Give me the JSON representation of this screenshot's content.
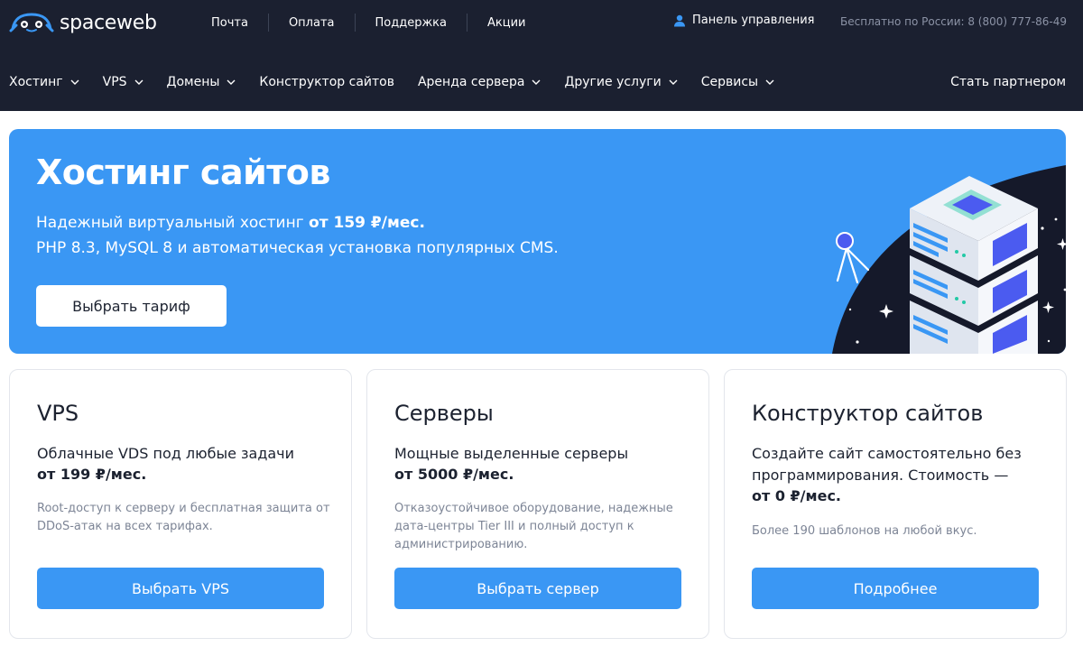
{
  "header": {
    "logo_text": "spaceweb",
    "top_links": [
      "Почта",
      "Оплата",
      "Поддержка",
      "Акции"
    ],
    "control_panel": "Панель управления",
    "phone": "Бесплатно по России: 8 (800) 777-86-49",
    "nav": [
      {
        "label": "Хостинг",
        "dropdown": true
      },
      {
        "label": "VPS",
        "dropdown": true
      },
      {
        "label": "Домены",
        "dropdown": true
      },
      {
        "label": "Конструктор сайтов",
        "dropdown": false
      },
      {
        "label": "Аренда сервера",
        "dropdown": true
      },
      {
        "label": "Другие услуги",
        "dropdown": true
      },
      {
        "label": "Сервисы",
        "dropdown": true
      }
    ],
    "partner": "Стать партнером"
  },
  "hero": {
    "title": "Хостинг сайтов",
    "line1_prefix": "Надежный виртуальный хостинг ",
    "line1_price": "от 159 ₽/мес.",
    "line2": "PHP 8.3, MySQL 8 и автоматическая установка популярных CMS.",
    "button": "Выбрать тариф"
  },
  "cards": [
    {
      "title": "VPS",
      "desc": "Облачные VDS под любые задачи",
      "price": "от 199 ₽/мес.",
      "note": "Root-доступ к серверу и бесплатная защита от DDoS-атак на всех тарифах.",
      "button": "Выбрать VPS"
    },
    {
      "title": "Серверы",
      "desc": "Мощные выделенные серверы",
      "price": "от 5000 ₽/мес.",
      "note": "Отказоустойчивое оборудование, надежные дата-центры Tier III и полный доступ к администрированию.",
      "button": "Выбрать сервер"
    },
    {
      "title": "Конструктор сайтов",
      "desc": "Создайте сайт самостоятельно без программирования. Стоимость —",
      "price": "от 0 ₽/мес.",
      "note": "Более 190 шаблонов на любой вкус.",
      "button": "Подробнее"
    }
  ],
  "colors": {
    "header_bg": "#1b2030",
    "accent": "#3a97f4",
    "text_dark": "#1c2230",
    "text_muted": "#7d8596"
  },
  "icons": [
    "logo-icon",
    "user-icon",
    "chevron-down-icon",
    "satellite-icon",
    "server-stack-icon",
    "star-icon"
  ]
}
